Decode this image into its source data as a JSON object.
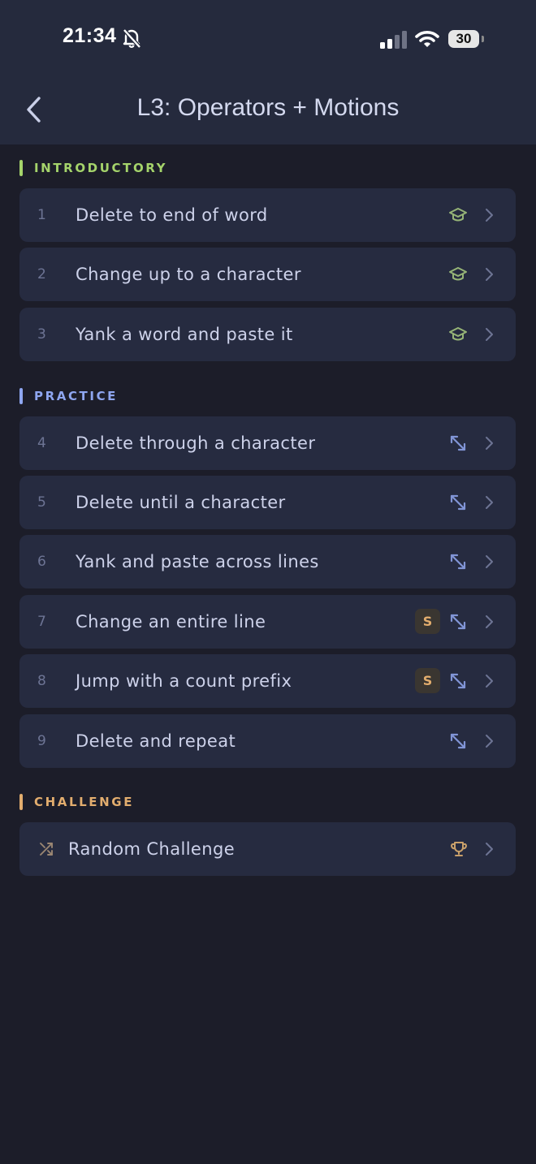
{
  "status": {
    "time": "21:34",
    "battery": "30"
  },
  "header": {
    "title": "L3: Operators + Motions"
  },
  "sections": [
    {
      "title": "INTRODUCTORY",
      "color": "#a5d46b"
    },
    {
      "title": "PRACTICE",
      "color": "#8ea6f0"
    },
    {
      "title": "CHALLENGE",
      "color": "#e2ad6e"
    }
  ],
  "introductory": [
    {
      "num": "1",
      "label": "Delete to end of word",
      "icon": "graduation-cap-icon"
    },
    {
      "num": "2",
      "label": "Change up to a character",
      "icon": "graduation-cap-icon"
    },
    {
      "num": "3",
      "label": "Yank a word and paste it",
      "icon": "graduation-cap-icon"
    }
  ],
  "practice": [
    {
      "num": "4",
      "label": "Delete through a character",
      "icon": "arrows-diagonal-icon"
    },
    {
      "num": "5",
      "label": "Delete until a character",
      "icon": "arrows-diagonal-icon"
    },
    {
      "num": "6",
      "label": "Yank and paste across lines",
      "icon": "arrows-diagonal-icon"
    },
    {
      "num": "7",
      "label": "Change an entire line",
      "badge": "S",
      "icon": "arrows-diagonal-icon"
    },
    {
      "num": "8",
      "label": "Jump with a count prefix",
      "badge": "S",
      "icon": "arrows-diagonal-icon"
    },
    {
      "num": "9",
      "label": "Delete and repeat",
      "icon": "arrows-diagonal-icon"
    }
  ],
  "challenge": {
    "label": "Random Challenge",
    "icon": "trophy-icon",
    "lead_icon": "shuffle-icon"
  }
}
